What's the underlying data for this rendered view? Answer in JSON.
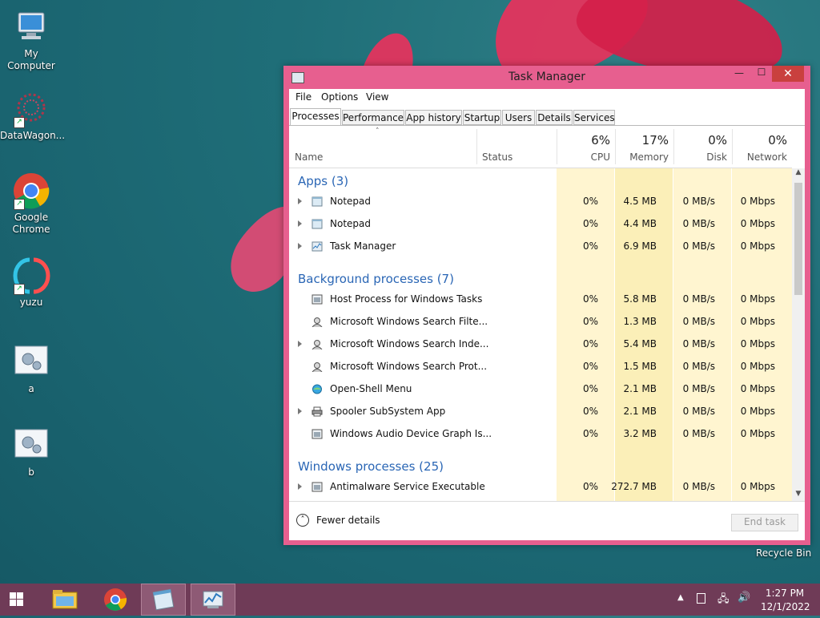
{
  "desktop": {
    "icons": [
      {
        "label": "My Computer",
        "icon": "computer-icon"
      },
      {
        "label": "DataWagon...",
        "icon": "datawagon-icon"
      },
      {
        "label": "Google Chrome",
        "icon": "chrome-icon"
      },
      {
        "label": "yuzu",
        "icon": "yuzu-icon"
      },
      {
        "label": "a",
        "icon": "settings-file-icon"
      },
      {
        "label": "b",
        "icon": "settings-file-icon"
      }
    ],
    "recycle_bin": "Recycle Bin"
  },
  "window": {
    "title": "Task Manager",
    "controls": {
      "minimize": "—",
      "maximize": "☐",
      "close": "✕"
    },
    "menu": [
      "File",
      "Options",
      "View"
    ],
    "tabs": [
      "Processes",
      "Performance",
      "App history",
      "Startup",
      "Users",
      "Details",
      "Services"
    ],
    "active_tab": "Processes",
    "columns": {
      "name": "Name",
      "status": "Status",
      "cpu": {
        "pct": "6%",
        "label": "CPU"
      },
      "memory": {
        "pct": "17%",
        "label": "Memory"
      },
      "disk": {
        "pct": "0%",
        "label": "Disk"
      },
      "network": {
        "pct": "0%",
        "label": "Network"
      }
    },
    "sections": [
      {
        "title": "Apps (3)",
        "rows": [
          {
            "name": "Notepad",
            "expandable": true,
            "icon": "notepad-icon",
            "cpu": "0%",
            "mem": "4.5 MB",
            "disk": "0 MB/s",
            "net": "0 Mbps"
          },
          {
            "name": "Notepad",
            "expandable": true,
            "icon": "notepad-icon",
            "cpu": "0%",
            "mem": "4.4 MB",
            "disk": "0 MB/s",
            "net": "0 Mbps"
          },
          {
            "name": "Task Manager",
            "expandable": true,
            "icon": "taskmanager-icon",
            "cpu": "0%",
            "mem": "6.9 MB",
            "disk": "0 MB/s",
            "net": "0 Mbps"
          }
        ]
      },
      {
        "title": "Background processes (7)",
        "rows": [
          {
            "name": "Host Process for Windows Tasks",
            "expandable": false,
            "icon": "window-icon",
            "cpu": "0%",
            "mem": "5.8 MB",
            "disk": "0 MB/s",
            "net": "0 Mbps"
          },
          {
            "name": "Microsoft Windows Search Filte...",
            "expandable": false,
            "icon": "search-user-icon",
            "cpu": "0%",
            "mem": "1.3 MB",
            "disk": "0 MB/s",
            "net": "0 Mbps"
          },
          {
            "name": "Microsoft Windows Search Inde...",
            "expandable": true,
            "icon": "search-user-icon",
            "cpu": "0%",
            "mem": "5.4 MB",
            "disk": "0 MB/s",
            "net": "0 Mbps"
          },
          {
            "name": "Microsoft Windows Search Prot...",
            "expandable": false,
            "icon": "search-user-icon",
            "cpu": "0%",
            "mem": "1.5 MB",
            "disk": "0 MB/s",
            "net": "0 Mbps"
          },
          {
            "name": "Open-Shell Menu",
            "expandable": false,
            "icon": "shell-icon",
            "cpu": "0%",
            "mem": "2.1 MB",
            "disk": "0 MB/s",
            "net": "0 Mbps"
          },
          {
            "name": "Spooler SubSystem App",
            "expandable": true,
            "icon": "printer-icon",
            "cpu": "0%",
            "mem": "2.1 MB",
            "disk": "0 MB/s",
            "net": "0 Mbps"
          },
          {
            "name": "Windows Audio Device Graph Is...",
            "expandable": false,
            "icon": "window-icon",
            "cpu": "0%",
            "mem": "3.2 MB",
            "disk": "0 MB/s",
            "net": "0 Mbps"
          }
        ]
      },
      {
        "title": "Windows processes (25)",
        "rows": [
          {
            "name": "Antimalware Service Executable",
            "expandable": true,
            "icon": "window-icon",
            "cpu": "0%",
            "mem": "272.7 MB",
            "disk": "0 MB/s",
            "net": "0 Mbps"
          }
        ]
      }
    ],
    "footer": {
      "fewer_details": "Fewer details",
      "end_task": "End task"
    }
  },
  "taskbar": {
    "buttons": [
      "start-icon",
      "file-explorer-icon",
      "chrome-icon",
      "notepad-icon",
      "taskmanager-icon"
    ],
    "time": "1:27 PM",
    "date": "12/1/2022",
    "tray_icons": [
      "chevron-up-icon",
      "action-center-icon",
      "network-icon",
      "volume-icon"
    ]
  },
  "colors": {
    "window_frame": "#e75f8f",
    "close_button": "#c9403e",
    "section_title": "#2a66b5",
    "heat_light": "#fff5d0",
    "heat_medium": "#fbefb8",
    "taskbar": "#6f3b57"
  }
}
